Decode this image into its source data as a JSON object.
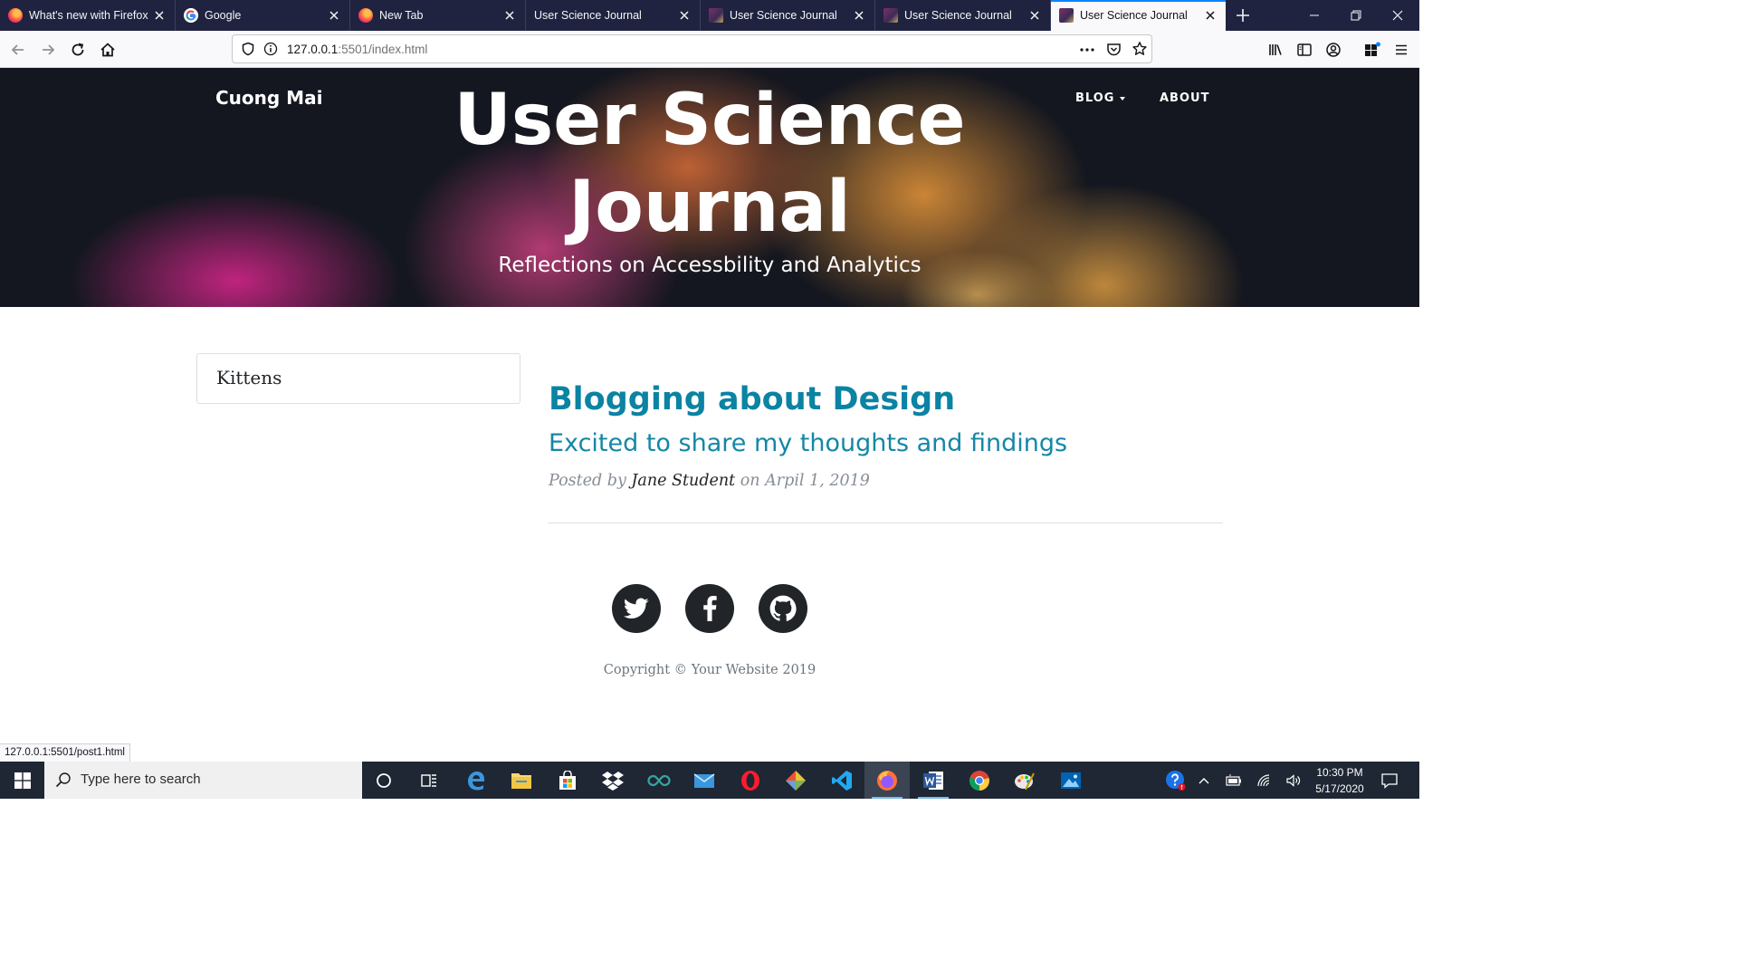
{
  "browser": {
    "tabs": [
      {
        "title": "What's new with Firefox",
        "favicon": "firefox-icon"
      },
      {
        "title": "Google",
        "favicon": "google-icon"
      },
      {
        "title": "New Tab",
        "favicon": "firefox-icon"
      },
      {
        "title": "User Science Journal",
        "favicon": ""
      },
      {
        "title": "User Science Journal",
        "favicon": "site-icon"
      },
      {
        "title": "User Science Journal",
        "favicon": "site-icon"
      },
      {
        "title": "User Science Journal",
        "favicon": "site-icon",
        "active": true
      }
    ],
    "url_host": "127.0.0.1",
    "url_rest": ":5501/index.html",
    "status_link": "127.0.0.1:5501/post1.html",
    "accent": "#0a84ff"
  },
  "site": {
    "brand": "Cuong Mai",
    "nav": {
      "blog": "BLOG",
      "about": "ABOUT"
    },
    "title_line1": "User Science",
    "title_line2": "Journal",
    "subtitle": "Reflections on Accessbility and Analytics",
    "sidebar_card": "Kittens",
    "post": {
      "title": "Blogging about Design",
      "subtitle": "Excited to share my thoughts and findings",
      "meta_prefix": "Posted by ",
      "author": "Jane Student",
      "meta_suffix": " on Arpil 1, 2019"
    },
    "social": [
      "twitter-icon",
      "facebook-icon",
      "github-icon"
    ],
    "copyright": "Copyright © Your Website 2019",
    "colors": {
      "post_title": "#0b83a3",
      "social_bg": "#212529"
    }
  },
  "taskbar": {
    "search_placeholder": "Type here to search",
    "time": "10:30 PM",
    "date": "5/17/2020",
    "apps": [
      "cortana-icon",
      "task-view-icon",
      "edge-icon",
      "file-explorer-icon",
      "store-icon",
      "dropbox-icon",
      "arduino-icon",
      "mail-icon",
      "opera-icon",
      "git-icon",
      "vscode-icon",
      "firefox-icon",
      "word-icon",
      "chrome-icon",
      "paint-icon",
      "photos-icon"
    ]
  }
}
